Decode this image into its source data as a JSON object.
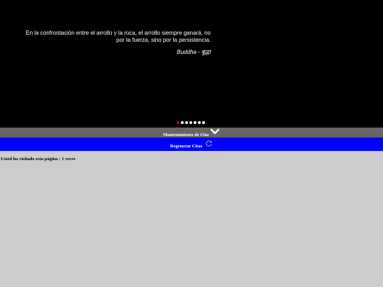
{
  "quote": {
    "text": "En la confrontación entre el arrollo y la roca, el arrollo siempre ganará, no por la fuerza, sino por la persistencia.",
    "author": "Buddha - बुद्धा"
  },
  "carousel": {
    "dot_count": 7,
    "active_index": 0
  },
  "maintenance": {
    "label": "Mantenimiento de Cita",
    "icon": "chevron-down-icon"
  },
  "regenerate": {
    "label": "Regenerar Citas",
    "icon": "refresh-icon"
  },
  "footer": {
    "visit_counter": "Usted ha visitado esta página : 1 veces"
  },
  "colors": {
    "quote_bg": "#000000",
    "maintenance_bg": "#666666",
    "regenerate_bg": "#0000ff",
    "page_bg": "#cccccc",
    "active_dot": "#cc0000"
  }
}
